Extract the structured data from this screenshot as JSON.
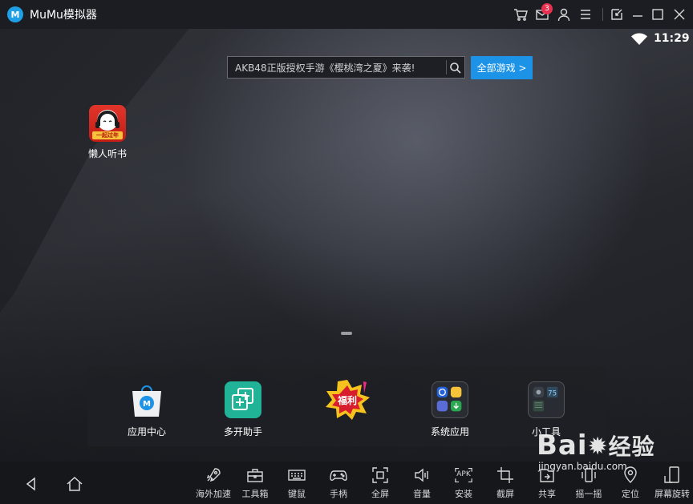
{
  "titlebar": {
    "logo_letter": "M",
    "title": "MuMu模拟器",
    "mail_badge": "3"
  },
  "status": {
    "time": "11:29"
  },
  "search": {
    "text": "AKB48正版授权手游《樱桃湾之夏》来袭!",
    "button_label": "全部游戏 >"
  },
  "desktop_apps": [
    {
      "label": "懒人听书",
      "banner": "一起过年"
    }
  ],
  "dock": {
    "apps": [
      {
        "label": "应用中心"
      },
      {
        "label": "多开助手"
      },
      {
        "label": "",
        "badge_text": "福利"
      },
      {
        "label": "系统应用"
      },
      {
        "label": "小工具"
      }
    ]
  },
  "toolbar": {
    "tools": [
      {
        "label": "海外加速",
        "icon": "rocket-icon"
      },
      {
        "label": "工具箱",
        "icon": "toolbox-icon"
      },
      {
        "label": "键鼠",
        "icon": "keyboard-icon"
      },
      {
        "label": "手柄",
        "icon": "gamepad-icon"
      },
      {
        "label": "全屏",
        "icon": "fullscreen-icon"
      },
      {
        "label": "音量",
        "icon": "volume-icon"
      },
      {
        "label": "安装",
        "icon": "apk-install-icon",
        "icon_text": "APK"
      },
      {
        "label": "截屏",
        "icon": "crop-icon"
      },
      {
        "label": "共享",
        "icon": "share-icon"
      },
      {
        "label": "摇一摇",
        "icon": "shake-icon"
      },
      {
        "label": "定位",
        "icon": "location-icon"
      },
      {
        "label": "屏幕旋转",
        "icon": "rotate-icon"
      }
    ]
  },
  "watermark": {
    "text": "Bai",
    "text2": "经验",
    "sub": "jingyan.baidu.com"
  },
  "colors": {
    "accent": "#1d93e8",
    "badge": "#e8304f",
    "titlebar_bg": "#1b1d22",
    "toolbar_bg": "#15171b"
  }
}
